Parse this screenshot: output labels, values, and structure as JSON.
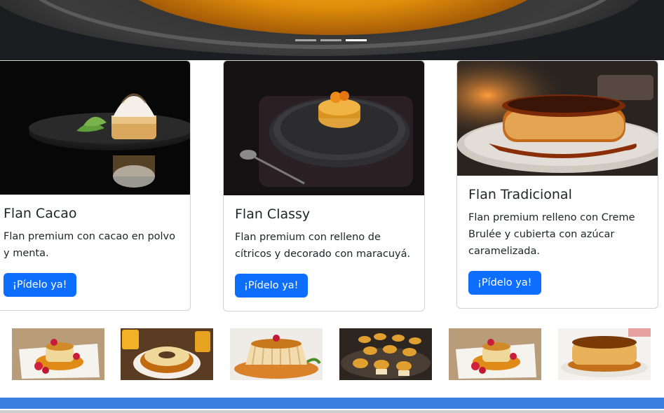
{
  "hero": {
    "indicators": [
      {
        "label": "Slide 1",
        "active": false
      },
      {
        "label": "Slide 2",
        "active": false
      },
      {
        "label": "Slide 3",
        "active": true
      }
    ]
  },
  "cards": [
    {
      "title": "Flan Cacao",
      "text": "Flan premium con cacao en polvo y menta.",
      "button": "¡Pídelo ya!"
    },
    {
      "title": "Flan Classy",
      "text": "Flan premium con relleno de cítricos y decorado con maracuyá.",
      "button": "¡Pídelo ya!"
    },
    {
      "title": "Flan Tradicional",
      "text": "Flan premium relleno con Creme Brulée y cubierta con azúcar caramelizada.",
      "button": "¡Pídelo ya!"
    }
  ],
  "gallery": {
    "thumbnails": [
      "flan-raspberry-plate",
      "flan-ring-drinks",
      "flan-fluted-raspberry",
      "flan-minis-tray",
      "flan-raspberry-plate-2",
      "flan-classic-caramel"
    ]
  },
  "colors": {
    "primary": "#0d6efd",
    "footer": "#3b7fe0"
  }
}
